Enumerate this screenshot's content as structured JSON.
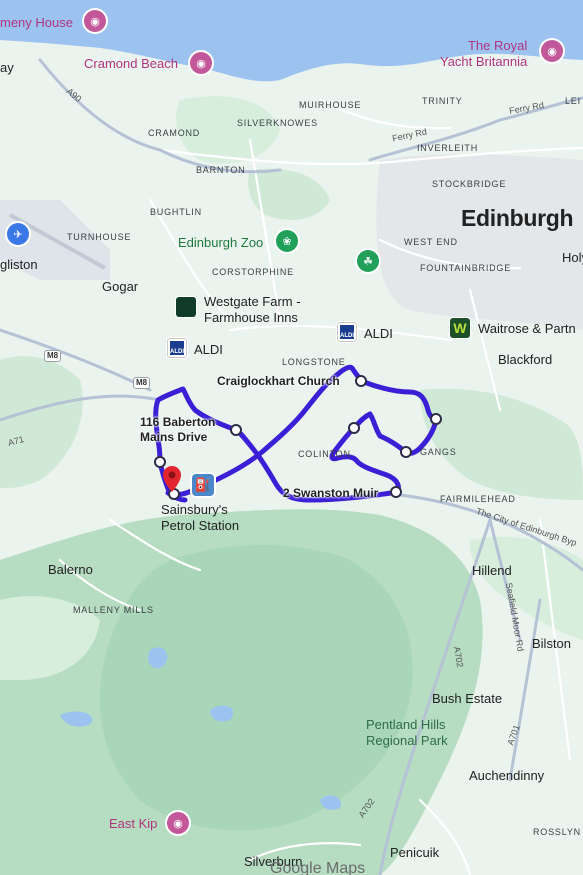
{
  "map": {
    "places_large": [
      {
        "name": "Edinburgh"
      }
    ],
    "places_medium": [
      {
        "name": "Gogar"
      },
      {
        "name": "Blackford"
      },
      {
        "name": "Balerno"
      },
      {
        "name": "Hillend"
      },
      {
        "name": "Bilston"
      },
      {
        "name": "Bush Estate"
      },
      {
        "name": "Auchendinny"
      },
      {
        "name": "Penicuik"
      },
      {
        "name": "Silverburn"
      },
      {
        "name": "gliston"
      },
      {
        "name": "Holy"
      },
      {
        "name": "Pentland Hills\nRegional Park"
      }
    ],
    "places_small": [
      {
        "name": "MUIRHOUSE"
      },
      {
        "name": "TRINITY"
      },
      {
        "name": "LEI"
      },
      {
        "name": "SILVERKNOWES"
      },
      {
        "name": "CRAMOND"
      },
      {
        "name": "INVERLEITH"
      },
      {
        "name": "BARNTON"
      },
      {
        "name": "STOCKBRIDGE"
      },
      {
        "name": "BUGHTLIN"
      },
      {
        "name": "TURNHOUSE"
      },
      {
        "name": "WEST END"
      },
      {
        "name": "CORSTORPHINE"
      },
      {
        "name": "FOUNTAINBRIDGE"
      },
      {
        "name": "LONGSTONE"
      },
      {
        "name": "COLINTON"
      },
      {
        "name": "MALLENY MILLS"
      },
      {
        "name": "ROSSLYN"
      },
      {
        "name": "ay"
      },
      {
        "name": "GANGS"
      }
    ],
    "pois": [
      {
        "name": "meny House",
        "style": "pink",
        "icon": "camera-icon"
      },
      {
        "name": "Cramond Beach",
        "style": "pink",
        "icon": "camera-icon"
      },
      {
        "name": "The Royal\nYacht Britannia",
        "style": "pink",
        "icon": "camera-icon"
      },
      {
        "name": "Edinburgh Zoo",
        "style": "green",
        "icon": "zoo-icon"
      },
      {
        "name": "Westgate Farm -\nFarmhouse Inns",
        "style": "dark",
        "icon": "restaurant-logo-icon"
      },
      {
        "name": "ALDI",
        "style": "dark",
        "icon": "aldi-logo-icon"
      },
      {
        "name": "ALDI",
        "style": "dark",
        "icon": "aldi-logo-icon"
      },
      {
        "name": "Waitrose & Partn",
        "style": "dark",
        "icon": "waitrose-logo-icon"
      },
      {
        "name": "Sainsbury's\nPetrol Station",
        "style": "dark",
        "icon": "fuel-icon"
      },
      {
        "name": "East Kip",
        "style": "pink",
        "icon": "camera-icon"
      }
    ],
    "route_labels": [
      {
        "text": "Craiglockhart Church"
      },
      {
        "text": "116 Baberton\nMains Drive"
      },
      {
        "text": "2 Swanston Muir"
      }
    ],
    "road_labels": [
      {
        "text": "Ferry Rd"
      },
      {
        "text": "Ferry Rd"
      },
      {
        "text": "A90"
      },
      {
        "text": "A71"
      },
      {
        "text": "The City of Edinburgh Byp"
      },
      {
        "text": "Seafield Moor Rd"
      },
      {
        "text": "A702"
      },
      {
        "text": "A702"
      },
      {
        "text": "A701"
      },
      {
        "text": "FAIRMILEHEAD"
      }
    ],
    "shields": [
      {
        "text": "M8"
      },
      {
        "text": "M8"
      }
    ],
    "attribution": "Google Maps",
    "colors": {
      "water": "#9cc3f0",
      "land": "#eaf3ee",
      "park": "#cfe9d6",
      "hills": "#b6dcc2",
      "route": "#3b1fd6",
      "roads": "#ffffff",
      "major_roads": "#b5c2d6"
    }
  }
}
